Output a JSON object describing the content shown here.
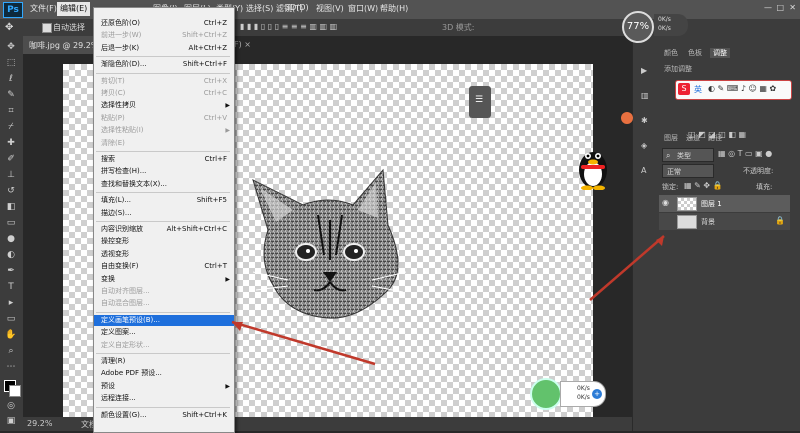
{
  "menubar": {
    "logo": "Ps",
    "items": [
      "文件(F)",
      "编辑(E)",
      "图像(I)",
      "图层(L)",
      "类型(Y)",
      "选择(S)",
      "滤镜(T)",
      "3D(D)",
      "视图(V)",
      "窗口(W)",
      "帮助(H)"
    ]
  },
  "options": {
    "auto_select": "自动选择"
  },
  "document": {
    "tab_title": "咖啡.jpg @ 29.2%(图层 1, RGB/8) *",
    "tab_suffix": "F) ×",
    "zoom": "29.2%",
    "status": "文档"
  },
  "edit_menu": {
    "items": [
      {
        "label": "还原色阶(O)",
        "shortcut": "Ctrl+Z",
        "disabled": false
      },
      {
        "label": "前进一步(W)",
        "shortcut": "Shift+Ctrl+Z",
        "disabled": true
      },
      {
        "label": "后退一步(K)",
        "shortcut": "Alt+Ctrl+Z",
        "disabled": false
      },
      {
        "label": "渐隐色阶(D)...",
        "shortcut": "Shift+Ctrl+F",
        "disabled": false
      },
      {
        "label": "剪切(T)",
        "shortcut": "Ctrl+X",
        "disabled": true
      },
      {
        "label": "拷贝(C)",
        "shortcut": "Ctrl+C",
        "disabled": true
      },
      {
        "label": "选择性拷贝",
        "shortcut": "",
        "disabled": false
      },
      {
        "label": "粘贴(P)",
        "shortcut": "Ctrl+V",
        "disabled": true
      },
      {
        "label": "选择性粘贴(I)",
        "shortcut": "",
        "disabled": true
      },
      {
        "label": "清除(E)",
        "shortcut": "",
        "disabled": true
      },
      {
        "label": "搜索",
        "shortcut": "Ctrl+F",
        "disabled": false
      },
      {
        "label": "拼写检查(H)...",
        "shortcut": "",
        "disabled": false
      },
      {
        "label": "查找和替换文本(X)...",
        "shortcut": "",
        "disabled": false
      },
      {
        "label": "填充(L)...",
        "shortcut": "Shift+F5",
        "disabled": false
      },
      {
        "label": "描边(S)...",
        "shortcut": "",
        "disabled": false
      },
      {
        "label": "内容识别缩放",
        "shortcut": "Alt+Shift+Ctrl+C",
        "disabled": false
      },
      {
        "label": "操控变形",
        "shortcut": "",
        "disabled": false
      },
      {
        "label": "透视变形",
        "shortcut": "",
        "disabled": false
      },
      {
        "label": "自由变换(F)",
        "shortcut": "Ctrl+T",
        "disabled": false
      },
      {
        "label": "变换",
        "shortcut": "",
        "disabled": false
      },
      {
        "label": "自动对齐图层...",
        "shortcut": "",
        "disabled": true
      },
      {
        "label": "自动混合图层...",
        "shortcut": "",
        "disabled": true
      },
      {
        "label": "定义画笔预设(B)...",
        "shortcut": "",
        "disabled": false
      },
      {
        "label": "定义图案...",
        "shortcut": "",
        "disabled": false
      },
      {
        "label": "定义自定形状...",
        "shortcut": "",
        "disabled": true
      },
      {
        "label": "清理(R)",
        "shortcut": "",
        "disabled": false
      },
      {
        "label": "Adobe PDF 预设...",
        "shortcut": "",
        "disabled": false
      },
      {
        "label": "预设",
        "shortcut": "",
        "disabled": false
      },
      {
        "label": "远程连接...",
        "shortcut": "",
        "disabled": false
      },
      {
        "label": "颜色设置(G)...",
        "shortcut": "Shift+Ctrl+K",
        "disabled": false
      }
    ]
  },
  "right_panel": {
    "tabs_top": [
      "颜色",
      "色板",
      "调整"
    ],
    "add_adjustment": "添加调整",
    "tabs_layers": [
      "图层",
      "通道",
      "路径"
    ],
    "kind_label": "类型",
    "blend_mode": "正常",
    "opacity_label": "不透明度:",
    "lock_label": "锁定:",
    "fill_label": "填充:",
    "layers": [
      {
        "name": "图层 1"
      },
      {
        "name": "背景"
      }
    ]
  },
  "speed_widget": {
    "percent": "77%",
    "up": "0K/s",
    "down": "0K/s"
  },
  "speed_widget2": {
    "percent": "",
    "up": "0K/s",
    "down": "0K/s"
  },
  "ime": {
    "logo": "S",
    "mode": "英"
  },
  "colors": {
    "highlight": "#1e6fdc",
    "menu_bg": "#f0f0f0",
    "arrow": "#c0392b"
  }
}
